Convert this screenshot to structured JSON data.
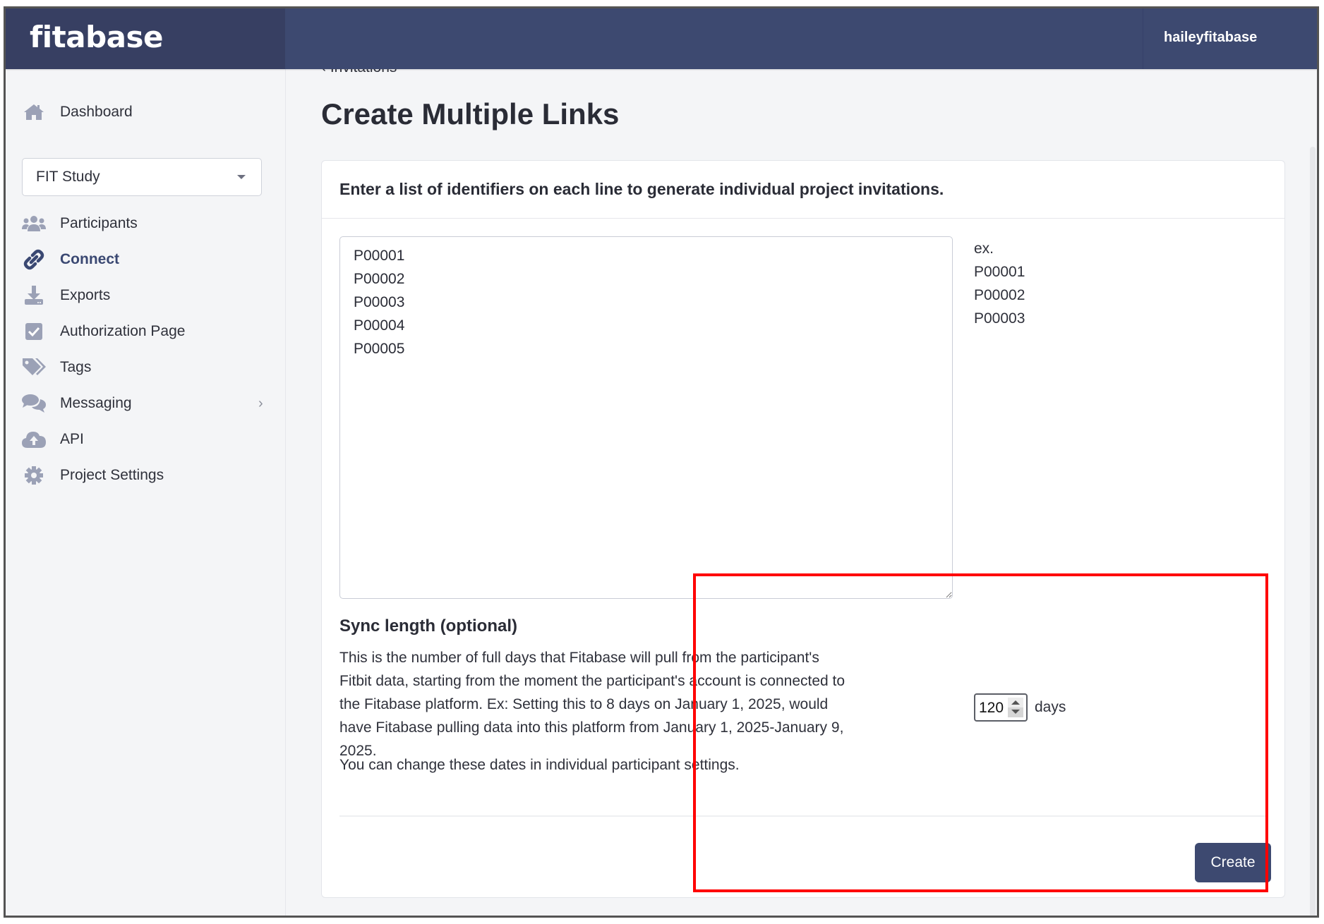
{
  "header": {
    "logo": "fitabase",
    "username": "haileyfitabase"
  },
  "sidebar": {
    "dashboard": {
      "label": "Dashboard",
      "icon": "home-icon"
    },
    "project_select": {
      "selected": "FIT Study"
    },
    "items": [
      {
        "label": "Participants",
        "icon": "users-icon",
        "active": false
      },
      {
        "label": "Connect",
        "icon": "link-icon",
        "active": true
      },
      {
        "label": "Exports",
        "icon": "download-icon",
        "active": false
      },
      {
        "label": "Authorization Page",
        "icon": "checkbox-icon",
        "active": false
      },
      {
        "label": "Tags",
        "icon": "tags-icon",
        "active": false
      },
      {
        "label": "Messaging",
        "icon": "comments-icon",
        "active": false,
        "has_submenu": true
      },
      {
        "label": "API",
        "icon": "cloud-upload-icon",
        "active": false
      },
      {
        "label": "Project Settings",
        "icon": "gear-icon",
        "active": false
      }
    ],
    "chevron": "›"
  },
  "main": {
    "breadcrumb": "‹ Invitations",
    "title": "Create Multiple Links",
    "card": {
      "header": "Enter a list of identifiers on each line to generate individual project invitations.",
      "identifiers_value": "P00001\nP00002\nP00003\nP00004\nP00005",
      "example": [
        "ex.",
        "P00001",
        "P00002",
        "P00003"
      ],
      "sync": {
        "title": "Sync length (optional)",
        "description": "This is the number of full days that Fitabase will pull from the participant's Fitbit data, starting from the moment the participant's account is connected to the Fitabase platform. Ex: Setting this to 8 days on January 1, 2025, would have Fitabase pulling data into this platform from January 1, 2025-January 9, 2025.",
        "note": "You can change these dates in individual participant settings.",
        "days_value": "120",
        "days_label": "days"
      },
      "create_label": "Create"
    }
  },
  "annotation": {
    "color": "#ff0000",
    "target": "sync-length-and-create-region"
  },
  "colors": {
    "header": "#3d4970",
    "accent": "#3a4872",
    "sidebar_bg": "#f4f5f7"
  }
}
